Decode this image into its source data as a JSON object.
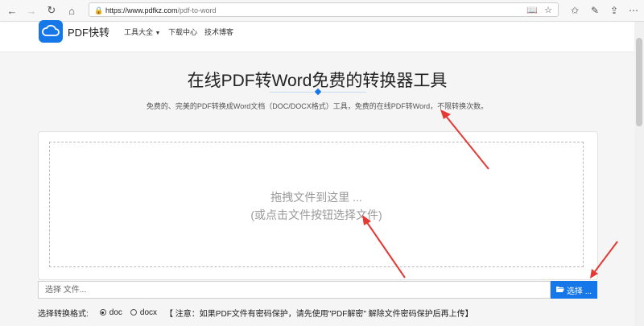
{
  "browser": {
    "url_host": "https://www.pdfkz.com",
    "url_path": "/pdf-to-word"
  },
  "header": {
    "logo_text": "PDF快转",
    "menu": [
      {
        "label": "工具大全",
        "has_dropdown": true
      },
      {
        "label": "下载中心"
      },
      {
        "label": "技术博客"
      }
    ]
  },
  "main": {
    "title": "在线PDF转Word免费的转换器工具",
    "subtitle": "免费的、完美的PDF转换成Word文档（DOC/DOCX格式）工具，免费的在线PDF转Word，不限转换次数。",
    "drop_line1": "拖拽文件到这里 ...",
    "drop_line2": "(或点击文件按钮选择文件)",
    "file_placeholder": "选择 文件...",
    "choose_label": "选择 ..."
  },
  "format": {
    "label": "选择转换格式:",
    "options": [
      {
        "label": "doc",
        "selected": true
      },
      {
        "label": "docx",
        "selected": false
      }
    ],
    "notice": "【 注意：如果PDF文件有密码保护，请先使用\"PDF解密\" 解除文件密码保护后再上传】"
  },
  "colors": {
    "accent": "#1677e8",
    "arrow": "#e53935"
  }
}
